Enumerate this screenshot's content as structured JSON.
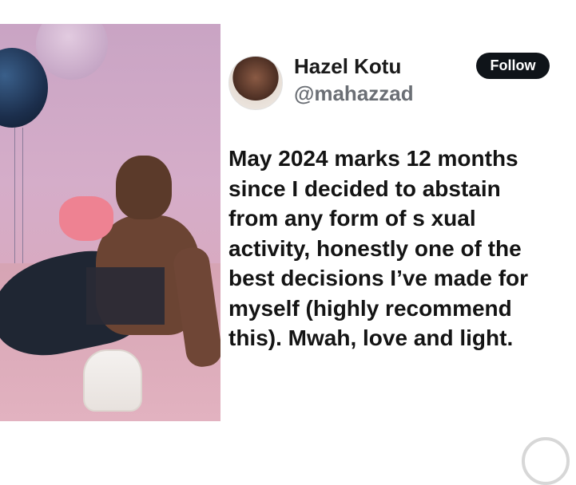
{
  "profile": {
    "display_name": "Hazel Kotu",
    "handle": "@mahazzad",
    "follow_label": "Follow"
  },
  "tweet": {
    "lines": [
      "May 2024 marks 12 months",
      "since I decided to abstain",
      "from any form of s xual",
      "activity, honestly one of the",
      "best decisions I’ve made for",
      "myself (highly recommend",
      "this). Mwah, love and light."
    ]
  },
  "colors": {
    "follow_bg": "#0f1419",
    "text": "#141414",
    "handle": "#6b6f75"
  }
}
